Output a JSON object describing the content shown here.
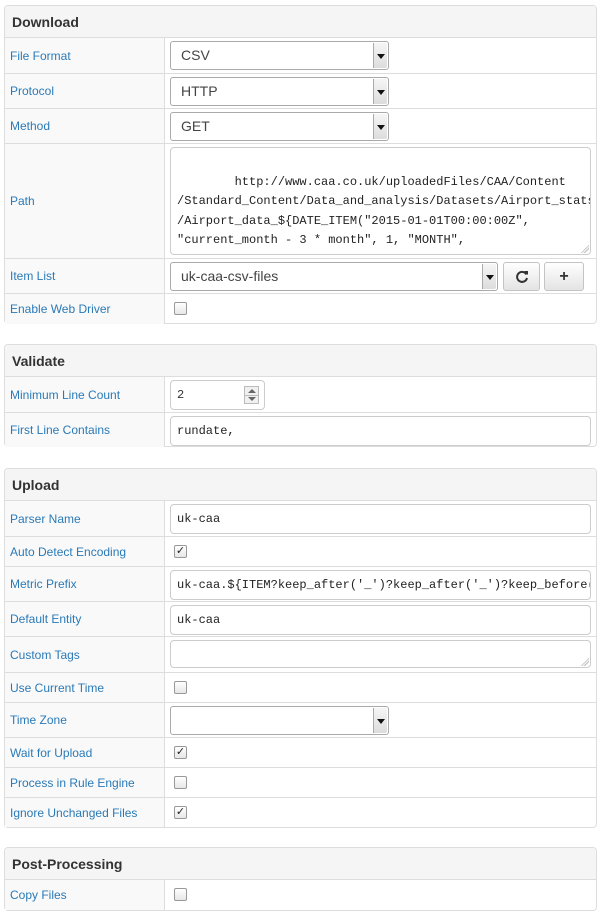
{
  "download": {
    "title": "Download",
    "file_format": {
      "label": "File Format",
      "value": "CSV"
    },
    "protocol": {
      "label": "Protocol",
      "value": "HTTP"
    },
    "method": {
      "label": "Method",
      "value": "GET"
    },
    "path": {
      "label": "Path",
      "value": "http://www.caa.co.uk/uploadedFiles/CAA/Content\n/Standard_Content/Data_and_analysis/Datasets/Airport_stats\n/Airport_data_${DATE_ITEM(\"2015-01-01T00:00:00Z\",\n\"current_month - 3 * month\", 1, \"MONTH\",\n\"yyyy_MM\")}/${ITEM}"
    },
    "item_list": {
      "label": "Item List",
      "value": "uk-caa-csv-files",
      "refresh_icon": "refresh-icon",
      "add_icon": "plus-icon",
      "add_label": "+"
    },
    "enable_web_driver": {
      "label": "Enable Web Driver",
      "checked": false
    }
  },
  "validate": {
    "title": "Validate",
    "minimum_line_count": {
      "label": "Minimum Line Count",
      "value": "2"
    },
    "first_line_contains": {
      "label": "First Line Contains",
      "value": "rundate,"
    }
  },
  "upload": {
    "title": "Upload",
    "parser_name": {
      "label": "Parser Name",
      "value": "uk-caa"
    },
    "auto_detect_encoding": {
      "label": "Auto Detect Encoding",
      "checked": true
    },
    "metric_prefix": {
      "label": "Metric Prefix",
      "value": "uk-caa.${ITEM?keep_after('_')?keep_after('_')?keep_before("
    },
    "default_entity": {
      "label": "Default Entity",
      "value": "uk-caa"
    },
    "custom_tags": {
      "label": "Custom Tags",
      "value": ""
    },
    "use_current_time": {
      "label": "Use Current Time",
      "checked": false
    },
    "time_zone": {
      "label": "Time Zone",
      "value": ""
    },
    "wait_for_upload": {
      "label": "Wait for Upload",
      "checked": true
    },
    "process_in_rule_engine": {
      "label": "Process in Rule Engine",
      "checked": false
    },
    "ignore_unchanged_files": {
      "label": "Ignore Unchanged Files",
      "checked": true
    }
  },
  "post_processing": {
    "title": "Post-Processing",
    "copy_files": {
      "label": "Copy Files",
      "checked": false
    }
  },
  "colors": {
    "label_link": "#2a7ab7",
    "heading_bg": "#f5f5f5",
    "border": "#dddddd"
  },
  "check_glyph": "✓"
}
